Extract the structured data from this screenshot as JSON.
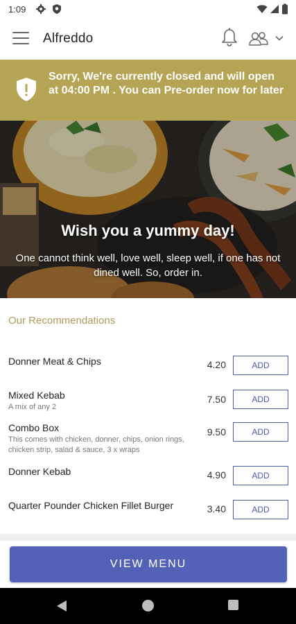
{
  "status_bar": {
    "time": "1:09",
    "icons": [
      "settings-icon",
      "shield-icon",
      "wifi-icon",
      "signal-icon",
      "battery-icon"
    ]
  },
  "app_bar": {
    "title": "Alfreddo",
    "icons": [
      "menu-icon",
      "bell-icon",
      "users-icon",
      "chevron-down-icon"
    ]
  },
  "notice": {
    "message": "Sorry, We're currently closed and will open at 04:00 PM . You can Pre-order now for later",
    "icon": "shield-alert-icon",
    "color": "#b4a454"
  },
  "hero": {
    "title": "Wish you a yummy day!",
    "subtitle": "One cannot think well, love well, sleep well, if one has not dined well. So, order in."
  },
  "recommendations": {
    "title": "Our Recommendations",
    "items": [
      {
        "name": "Donner Meat & Chips",
        "description": "",
        "price": "4.20",
        "button": "ADD"
      },
      {
        "name": "Mixed Kebab",
        "description": "A mix of any 2",
        "price": "7.50",
        "button": "ADD"
      },
      {
        "name": "Combo Box",
        "description": "This comes with chicken, donner, chips, onion rings, chicken strip, salad & sauce, 3 x wraps",
        "price": "9.50",
        "button": "ADD"
      },
      {
        "name": "Donner Kebab",
        "description": "",
        "price": "4.90",
        "button": "ADD"
      },
      {
        "name": "Quarter Pounder Chicken Fillet Burger",
        "description": "",
        "price": "3.40",
        "button": "ADD"
      }
    ]
  },
  "view_menu": {
    "label": "VIEW MENU",
    "color": "#5362b6"
  },
  "nav_bar": {
    "icons": [
      "back-icon",
      "home-icon",
      "recent-apps-icon"
    ]
  }
}
